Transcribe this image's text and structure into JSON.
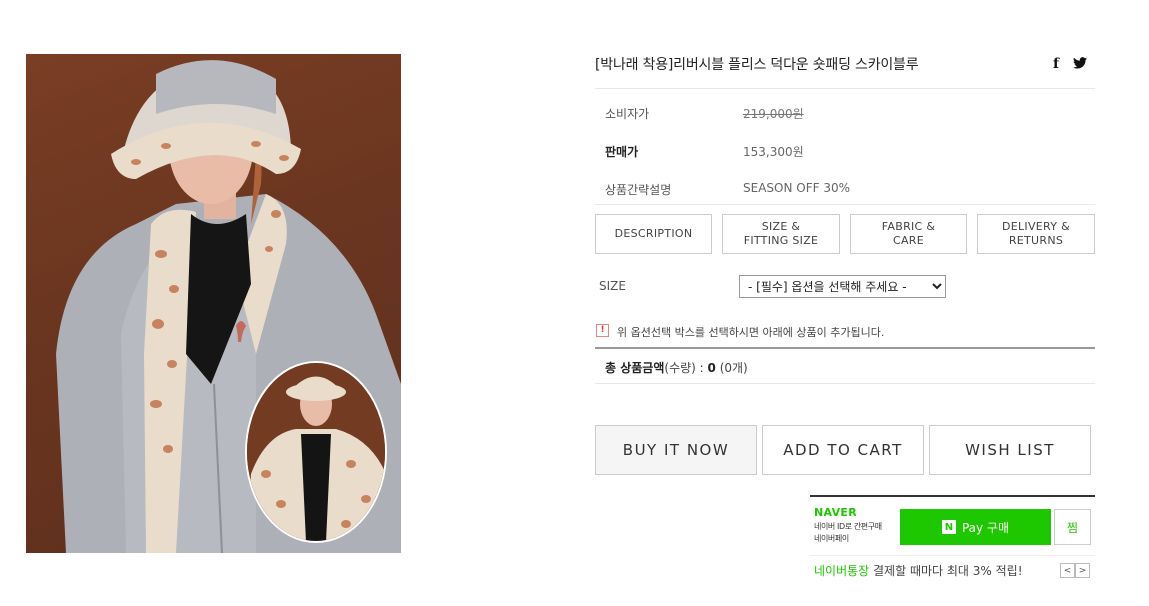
{
  "product": {
    "title": "[박나래 착용]리버시블 플리스 덕다운 숏패딩 스카이블루",
    "image_alt": "product-photo"
  },
  "social": {
    "facebook": "f",
    "twitter": "🐦"
  },
  "info": {
    "consumer_price_label": "소비자가",
    "consumer_price": "219,000원",
    "sale_price_label": "판매가",
    "sale_price": "153,300원",
    "summary_label": "상품간략설명",
    "summary": "SEASON OFF 30%"
  },
  "tabs": [
    {
      "label": "DESCRIPTION"
    },
    {
      "label": "SIZE &\nFITTING SIZE"
    },
    {
      "label": "FABRIC &\nCARE"
    },
    {
      "label": "DELIVERY &\nRETURNS"
    }
  ],
  "size": {
    "label": "SIZE",
    "selected": "- [필수] 옵션을 선택해 주세요 -"
  },
  "notice": {
    "icon": "!",
    "text": "위 옵션선택 박스를 선택하시면 아래에 상품이 추가됩니다."
  },
  "total": {
    "label": "총 상품금액",
    "qty_label": "(수량) : ",
    "amount": "0",
    "count": " (0개)"
  },
  "actions": {
    "buy": "BUY IT NOW",
    "cart": "ADD TO CART",
    "wish": "WISH LIST"
  },
  "npay": {
    "logo": "NAVER",
    "sub_line1": "네이버 ID로 간편구매",
    "sub_line2": "네이버페이",
    "button_n": "N",
    "button": "Pay 구매",
    "zzim": "찜",
    "promo_green": "네이버통장",
    "promo_rest": " 결제할 때마다 최대 3% 적립!",
    "prev": "<",
    "next": ">"
  },
  "colors": {
    "naver_green": "#1ec800",
    "background_brown": "#6b3620",
    "jacket_gray": "#aeb0b8"
  }
}
